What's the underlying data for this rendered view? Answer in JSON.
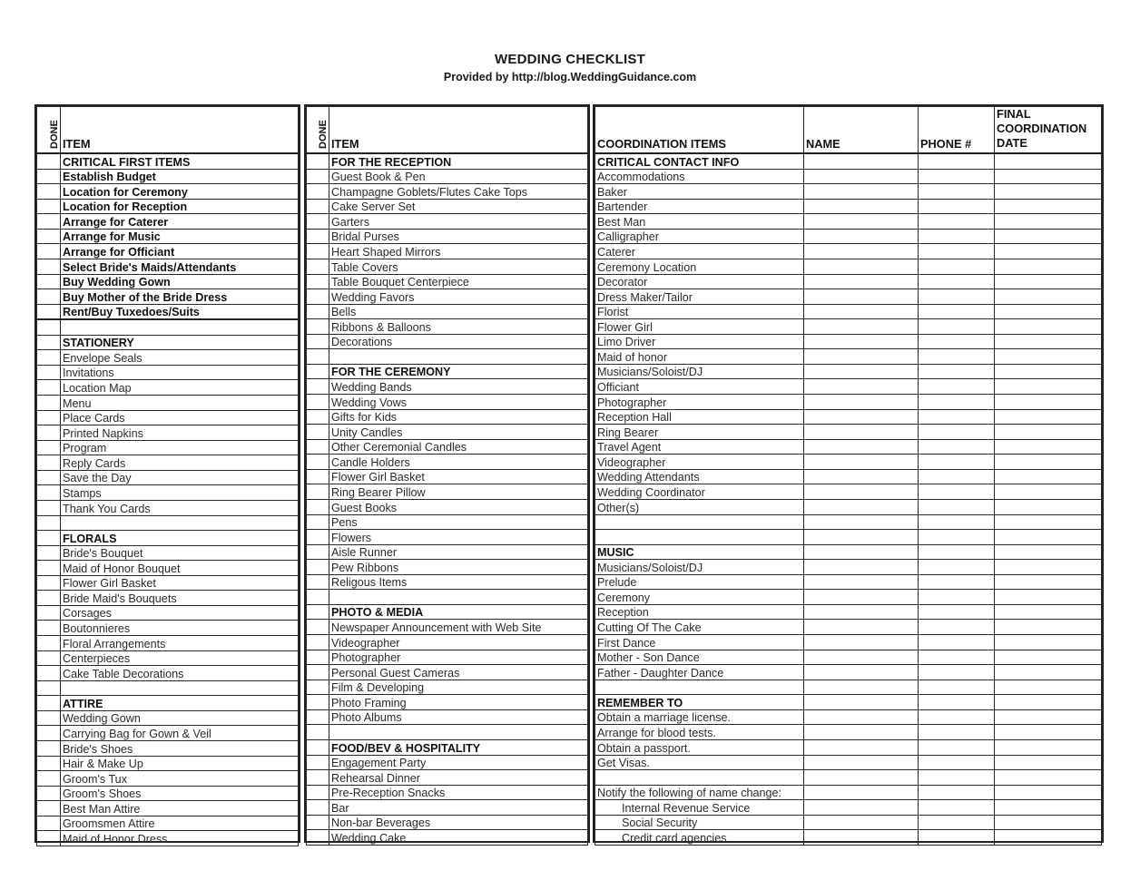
{
  "title": "WEDDING CHECKLIST",
  "subtitle": "Provided by http://blog.WeddingGuidance.com",
  "left_block": {
    "headers": {
      "done": "DONE",
      "item": "ITEM"
    },
    "rows": [
      {
        "text": "CRITICAL FIRST ITEMS",
        "style": "head"
      },
      {
        "text": "Establish Budget",
        "style": "bold"
      },
      {
        "text": "Location for Ceremony",
        "style": "bold"
      },
      {
        "text": "Location for Reception",
        "style": "bold"
      },
      {
        "text": "Arrange for Caterer",
        "style": "bold"
      },
      {
        "text": "Arrange for Music",
        "style": "bold"
      },
      {
        "text": "Arrange for Officiant",
        "style": "bold"
      },
      {
        "text": "Select Bride's Maids/Attendants",
        "style": "bold"
      },
      {
        "text": "Buy Wedding Gown",
        "style": "bold"
      },
      {
        "text": "Buy Mother of the Bride Dress",
        "style": "bold"
      },
      {
        "text": "Rent/Buy Tuxedoes/Suits",
        "style": "boldend"
      },
      {
        "text": "",
        "style": ""
      },
      {
        "text": "STATIONERY",
        "style": "head"
      },
      {
        "text": "Envelope Seals",
        "style": ""
      },
      {
        "text": "Invitations",
        "style": ""
      },
      {
        "text": "Location Map",
        "style": ""
      },
      {
        "text": "Menu",
        "style": ""
      },
      {
        "text": "Place Cards",
        "style": ""
      },
      {
        "text": "Printed Napkins",
        "style": ""
      },
      {
        "text": "Program",
        "style": ""
      },
      {
        "text": "Reply Cards",
        "style": ""
      },
      {
        "text": "Save the Day",
        "style": ""
      },
      {
        "text": "Stamps",
        "style": ""
      },
      {
        "text": "Thank You Cards",
        "style": ""
      },
      {
        "text": "",
        "style": ""
      },
      {
        "text": "FLORALS",
        "style": "head"
      },
      {
        "text": "Bride's Bouquet",
        "style": ""
      },
      {
        "text": "Maid of Honor Bouquet",
        "style": ""
      },
      {
        "text": "Flower Girl Basket",
        "style": ""
      },
      {
        "text": "Bride Maid's Bouquets",
        "style": ""
      },
      {
        "text": "Corsages",
        "style": ""
      },
      {
        "text": "Boutonnieres",
        "style": ""
      },
      {
        "text": "Floral Arrangements",
        "style": ""
      },
      {
        "text": "Centerpieces",
        "style": ""
      },
      {
        "text": "Cake Table Decorations",
        "style": ""
      },
      {
        "text": "",
        "style": ""
      },
      {
        "text": "ATTIRE",
        "style": "head"
      },
      {
        "text": "Wedding Gown",
        "style": ""
      },
      {
        "text": "Carrying Bag for Gown & Veil",
        "style": ""
      },
      {
        "text": "Bride's Shoes",
        "style": ""
      },
      {
        "text": "Hair & Make Up",
        "style": ""
      },
      {
        "text": "Groom's Tux",
        "style": ""
      },
      {
        "text": "Groom's Shoes",
        "style": ""
      },
      {
        "text": "Best Man Attire",
        "style": ""
      },
      {
        "text": "Groomsmen Attire",
        "style": ""
      },
      {
        "text": "Maid of Honor Dress",
        "style": ""
      }
    ]
  },
  "middle_block": {
    "headers": {
      "done": "DONE",
      "item": "ITEM"
    },
    "rows": [
      {
        "text": "FOR THE RECEPTION",
        "style": "head"
      },
      {
        "text": "Guest Book & Pen",
        "style": ""
      },
      {
        "text": "Champagne Goblets/Flutes Cake Tops",
        "style": ""
      },
      {
        "text": "Cake Server Set",
        "style": ""
      },
      {
        "text": "Garters",
        "style": ""
      },
      {
        "text": "Bridal Purses",
        "style": ""
      },
      {
        "text": "Heart Shaped Mirrors",
        "style": ""
      },
      {
        "text": "Table Covers",
        "style": ""
      },
      {
        "text": "Table Bouquet Centerpiece",
        "style": ""
      },
      {
        "text": "Wedding Favors",
        "style": ""
      },
      {
        "text": "Bells",
        "style": ""
      },
      {
        "text": "Ribbons & Balloons",
        "style": ""
      },
      {
        "text": "Decorations",
        "style": ""
      },
      {
        "text": "",
        "style": ""
      },
      {
        "text": "FOR THE CEREMONY",
        "style": "head"
      },
      {
        "text": "Wedding Bands",
        "style": ""
      },
      {
        "text": "Wedding Vows",
        "style": ""
      },
      {
        "text": "Gifts for Kids",
        "style": ""
      },
      {
        "text": "Unity Candles",
        "style": ""
      },
      {
        "text": "Other Ceremonial Candles",
        "style": ""
      },
      {
        "text": "Candle Holders",
        "style": ""
      },
      {
        "text": "Flower Girl Basket",
        "style": ""
      },
      {
        "text": "Ring Bearer Pillow",
        "style": ""
      },
      {
        "text": "Guest Books",
        "style": ""
      },
      {
        "text": "Pens",
        "style": ""
      },
      {
        "text": "Flowers",
        "style": ""
      },
      {
        "text": "Aisle Runner",
        "style": ""
      },
      {
        "text": "Pew Ribbons",
        "style": ""
      },
      {
        "text": "Religous Items",
        "style": ""
      },
      {
        "text": "",
        "style": ""
      },
      {
        "text": "PHOTO & MEDIA",
        "style": "head"
      },
      {
        "text": "Newspaper Announcement with Web Site",
        "style": ""
      },
      {
        "text": "Videographer",
        "style": ""
      },
      {
        "text": "Photographer",
        "style": ""
      },
      {
        "text": "Personal Guest Cameras",
        "style": ""
      },
      {
        "text": "Film & Developing",
        "style": ""
      },
      {
        "text": "Photo Framing",
        "style": ""
      },
      {
        "text": "Photo Albums",
        "style": ""
      },
      {
        "text": "",
        "style": ""
      },
      {
        "text": "FOOD/BEV & HOSPITALITY",
        "style": "head"
      },
      {
        "text": "Engagement Party",
        "style": ""
      },
      {
        "text": "Rehearsal Dinner",
        "style": ""
      },
      {
        "text": "Pre-Reception Snacks",
        "style": ""
      },
      {
        "text": "Bar",
        "style": ""
      },
      {
        "text": "Non-bar Beverages",
        "style": ""
      },
      {
        "text": "Wedding Cake",
        "style": ""
      }
    ]
  },
  "right_block": {
    "headers": {
      "coordination": "COORDINATION ITEMS",
      "name": "NAME",
      "phone": "PHONE #",
      "date_line1": "FINAL",
      "date_line2": "COORDINATION",
      "date_line3": "DATE"
    },
    "rows": [
      {
        "text": "CRITICAL CONTACT INFO",
        "style": "head"
      },
      {
        "text": "Accommodations",
        "style": ""
      },
      {
        "text": "Baker",
        "style": ""
      },
      {
        "text": "Bartender",
        "style": ""
      },
      {
        "text": "Best Man",
        "style": ""
      },
      {
        "text": "Calligrapher",
        "style": ""
      },
      {
        "text": "Caterer",
        "style": ""
      },
      {
        "text": "Ceremony Location",
        "style": ""
      },
      {
        "text": "Decorator",
        "style": ""
      },
      {
        "text": "Dress Maker/Tailor",
        "style": ""
      },
      {
        "text": "Florist",
        "style": ""
      },
      {
        "text": "Flower Girl",
        "style": ""
      },
      {
        "text": "Limo Driver",
        "style": ""
      },
      {
        "text": "Maid of honor",
        "style": ""
      },
      {
        "text": "Musicians/Soloist/DJ",
        "style": ""
      },
      {
        "text": "Officiant",
        "style": ""
      },
      {
        "text": "Photographer",
        "style": ""
      },
      {
        "text": "Reception Hall",
        "style": ""
      },
      {
        "text": "Ring Bearer",
        "style": ""
      },
      {
        "text": "Travel Agent",
        "style": ""
      },
      {
        "text": "Videographer",
        "style": ""
      },
      {
        "text": "Wedding Attendants",
        "style": ""
      },
      {
        "text": "Wedding Coordinator",
        "style": ""
      },
      {
        "text": "Other(s)",
        "style": ""
      },
      {
        "text": "",
        "style": ""
      },
      {
        "text": "",
        "style": ""
      },
      {
        "text": "MUSIC",
        "style": "head"
      },
      {
        "text": "Musicians/Soloist/DJ",
        "style": ""
      },
      {
        "text": "Prelude",
        "style": ""
      },
      {
        "text": "Ceremony",
        "style": ""
      },
      {
        "text": "Reception",
        "style": ""
      },
      {
        "text": "Cutting Of The Cake",
        "style": ""
      },
      {
        "text": "First Dance",
        "style": ""
      },
      {
        "text": "Mother - Son Dance",
        "style": ""
      },
      {
        "text": "Father - Daughter Dance",
        "style": ""
      },
      {
        "text": "",
        "style": ""
      },
      {
        "text": "REMEMBER TO",
        "style": "head"
      },
      {
        "text": "Obtain a marriage license.",
        "style": ""
      },
      {
        "text": "Arrange for blood tests.",
        "style": ""
      },
      {
        "text": "Obtain a passport.",
        "style": ""
      },
      {
        "text": "Get Visas.",
        "style": ""
      },
      {
        "text": "",
        "style": ""
      },
      {
        "text": "Notify the following of name change:",
        "style": ""
      },
      {
        "text": "Internal Revenue Service",
        "style": "indent"
      },
      {
        "text": "Social Security",
        "style": "indent"
      },
      {
        "text": "Credit card agencies",
        "style": "indent"
      }
    ]
  }
}
